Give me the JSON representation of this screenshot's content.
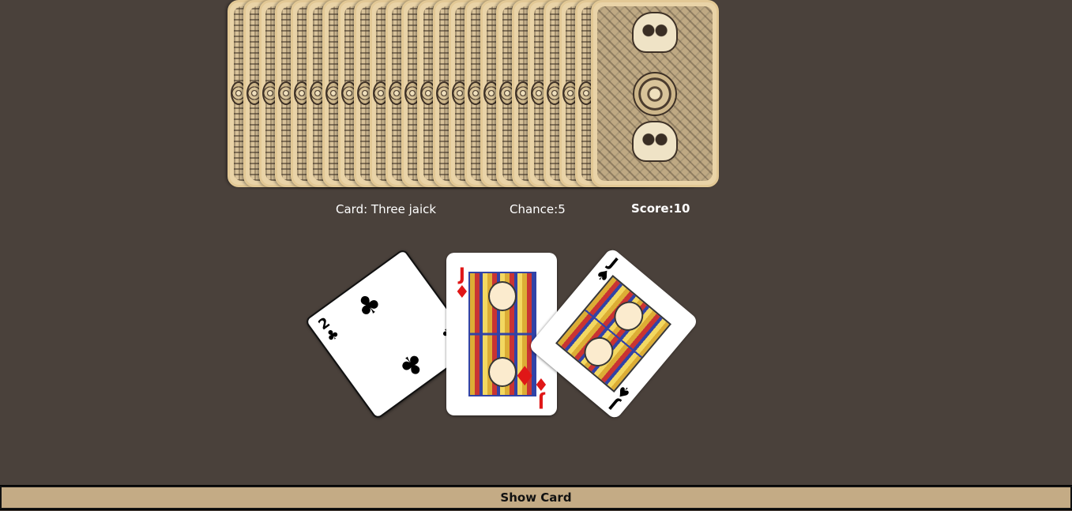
{
  "status": {
    "card_text": "Card: Three jaick",
    "chance_text": "Chance:5",
    "score_text": "Score:10"
  },
  "deck": {
    "card_count": 24,
    "back_icon": "sugar-skull-card-back-icon"
  },
  "hand": [
    {
      "rank": "2",
      "suit": "♣",
      "suit_name": "clubs",
      "color": "#000000"
    },
    {
      "rank": "J",
      "suit": "♦",
      "suit_name": "diamonds",
      "color": "#e01717"
    },
    {
      "rank": "J",
      "suit": "♠",
      "suit_name": "spades",
      "color": "#000000"
    }
  ],
  "button": {
    "show_card_label": "Show Card"
  },
  "colors": {
    "background": "#4a413b",
    "button": "#c4ab85",
    "card_back": "#e9d3a7"
  }
}
